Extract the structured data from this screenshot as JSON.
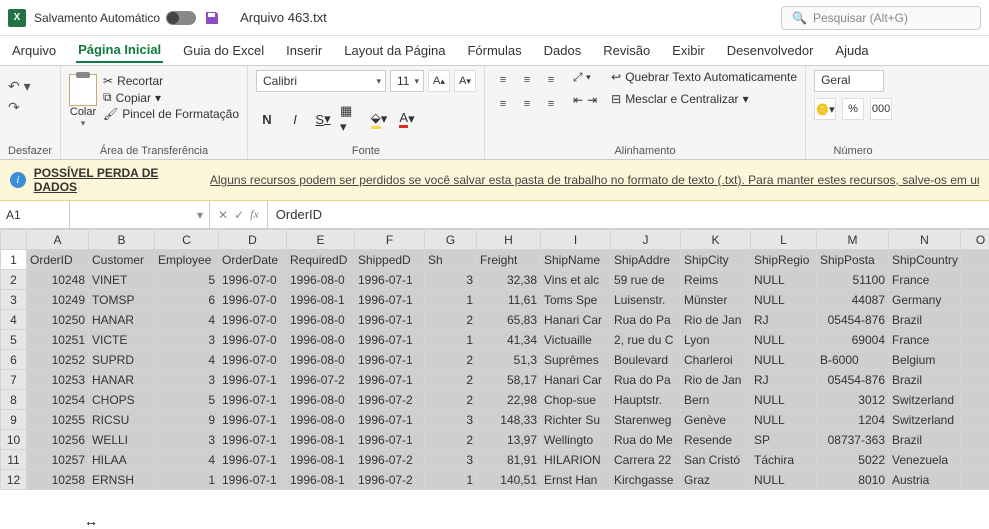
{
  "titlebar": {
    "autosave_label": "Salvamento Automático",
    "filename": "Arquivo 463.txt",
    "search_placeholder": "Pesquisar (Alt+G)"
  },
  "tabs": {
    "arquivo": "Arquivo",
    "pagina_inicial": "Página Inicial",
    "guia_excel": "Guia do Excel",
    "inserir": "Inserir",
    "layout": "Layout da Página",
    "formulas": "Fórmulas",
    "dados": "Dados",
    "revisao": "Revisão",
    "exibir": "Exibir",
    "desenvolvedor": "Desenvolvedor",
    "ajuda": "Ajuda"
  },
  "ribbon": {
    "undo_group": "Desfazer",
    "clipboard": {
      "colar": "Colar",
      "recortar": "Recortar",
      "copiar": "Copiar",
      "pincel": "Pincel de Formatação",
      "label": "Área de Transferência"
    },
    "font": {
      "name": "Calibri",
      "size": "11",
      "increase": "A",
      "decrease": "A",
      "bold": "N",
      "italic": "I",
      "underline": "S",
      "label": "Fonte"
    },
    "alignment": {
      "wrap": "Quebrar Texto Automaticamente",
      "merge": "Mesclar e Centralizar",
      "label": "Alinhamento"
    },
    "number": {
      "format": "Geral",
      "label": "Número"
    }
  },
  "warning": {
    "title": "POSSÍVEL PERDA DE DADOS",
    "msg": "Alguns recursos podem ser perdidos se você salvar esta pasta de trabalho no formato de texto (.txt). Para manter estes recursos, salve-os em um f"
  },
  "formula_bar": {
    "name_box": "A1",
    "value": "OrderID"
  },
  "chart_data": {
    "type": "table",
    "columns": [
      "A",
      "B",
      "C",
      "D",
      "E",
      "F",
      "G",
      "H",
      "I",
      "J",
      "K",
      "L",
      "M",
      "N",
      "O"
    ],
    "headers_row": [
      "OrderID",
      "Customer",
      "Employee",
      "OrderDate",
      "RequiredD",
      "ShippedD",
      "Sh",
      "Freight",
      "ShipName",
      "ShipAddre",
      "ShipCity",
      "ShipRegio",
      "ShipPosta",
      "ShipCountry",
      ""
    ],
    "rows": [
      [
        "10248",
        "VINET",
        "5",
        "1996-07-0",
        "1996-08-0",
        "1996-07-1",
        "3",
        "32,38",
        "Vins et alc",
        "59 rue de",
        "Reims",
        "NULL",
        "51100",
        "France",
        ""
      ],
      [
        "10249",
        "TOMSP",
        "6",
        "1996-07-0",
        "1996-08-1",
        "1996-07-1",
        "1",
        "11,61",
        "Toms Spe",
        "Luisenstr.",
        "Münster",
        "NULL",
        "44087",
        "Germany",
        ""
      ],
      [
        "10250",
        "HANAR",
        "4",
        "1996-07-0",
        "1996-08-0",
        "1996-07-1",
        "2",
        "65,83",
        "Hanari Car",
        "Rua do Pa",
        "Rio de Jan",
        "RJ",
        "05454-876",
        "Brazil",
        ""
      ],
      [
        "10251",
        "VICTE",
        "3",
        "1996-07-0",
        "1996-08-0",
        "1996-07-1",
        "1",
        "41,34",
        "Victuaille",
        "2, rue du C",
        "Lyon",
        "NULL",
        "69004",
        "France",
        ""
      ],
      [
        "10252",
        "SUPRD",
        "4",
        "1996-07-0",
        "1996-08-0",
        "1996-07-1",
        "2",
        "51,3",
        "Suprêmes",
        "Boulevard",
        "Charleroi",
        "NULL",
        "B-6000",
        "Belgium",
        ""
      ],
      [
        "10253",
        "HANAR",
        "3",
        "1996-07-1",
        "1996-07-2",
        "1996-07-1",
        "2",
        "58,17",
        "Hanari Car",
        "Rua do Pa",
        "Rio de Jan",
        "RJ",
        "05454-876",
        "Brazil",
        ""
      ],
      [
        "10254",
        "CHOPS",
        "5",
        "1996-07-1",
        "1996-08-0",
        "1996-07-2",
        "2",
        "22,98",
        "Chop-sue",
        "Hauptstr.",
        "Bern",
        "NULL",
        "3012",
        "Switzerland",
        ""
      ],
      [
        "10255",
        "RICSU",
        "9",
        "1996-07-1",
        "1996-08-0",
        "1996-07-1",
        "3",
        "148,33",
        "Richter Su",
        "Starenweg",
        "Genève",
        "NULL",
        "1204",
        "Switzerland",
        ""
      ],
      [
        "10256",
        "WELLI",
        "3",
        "1996-07-1",
        "1996-08-1",
        "1996-07-1",
        "2",
        "13,97",
        "Wellingto",
        "Rua do Me",
        "Resende",
        "SP",
        "08737-363",
        "Brazil",
        ""
      ],
      [
        "10257",
        "HILAA",
        "4",
        "1996-07-1",
        "1996-08-1",
        "1996-07-2",
        "3",
        "81,91",
        "HILARION",
        "Carrera 22",
        "San Cristó",
        "Táchira",
        "5022",
        "Venezuela",
        ""
      ],
      [
        "10258",
        "ERNSH",
        "1",
        "1996-07-1",
        "1996-08-1",
        "1996-07-2",
        "1",
        "140,51",
        "Ernst Han",
        "Kirchgasse",
        "Graz",
        "NULL",
        "8010",
        "Austria",
        ""
      ]
    ]
  },
  "numeric_cols": [
    0,
    2,
    6,
    7,
    12
  ]
}
